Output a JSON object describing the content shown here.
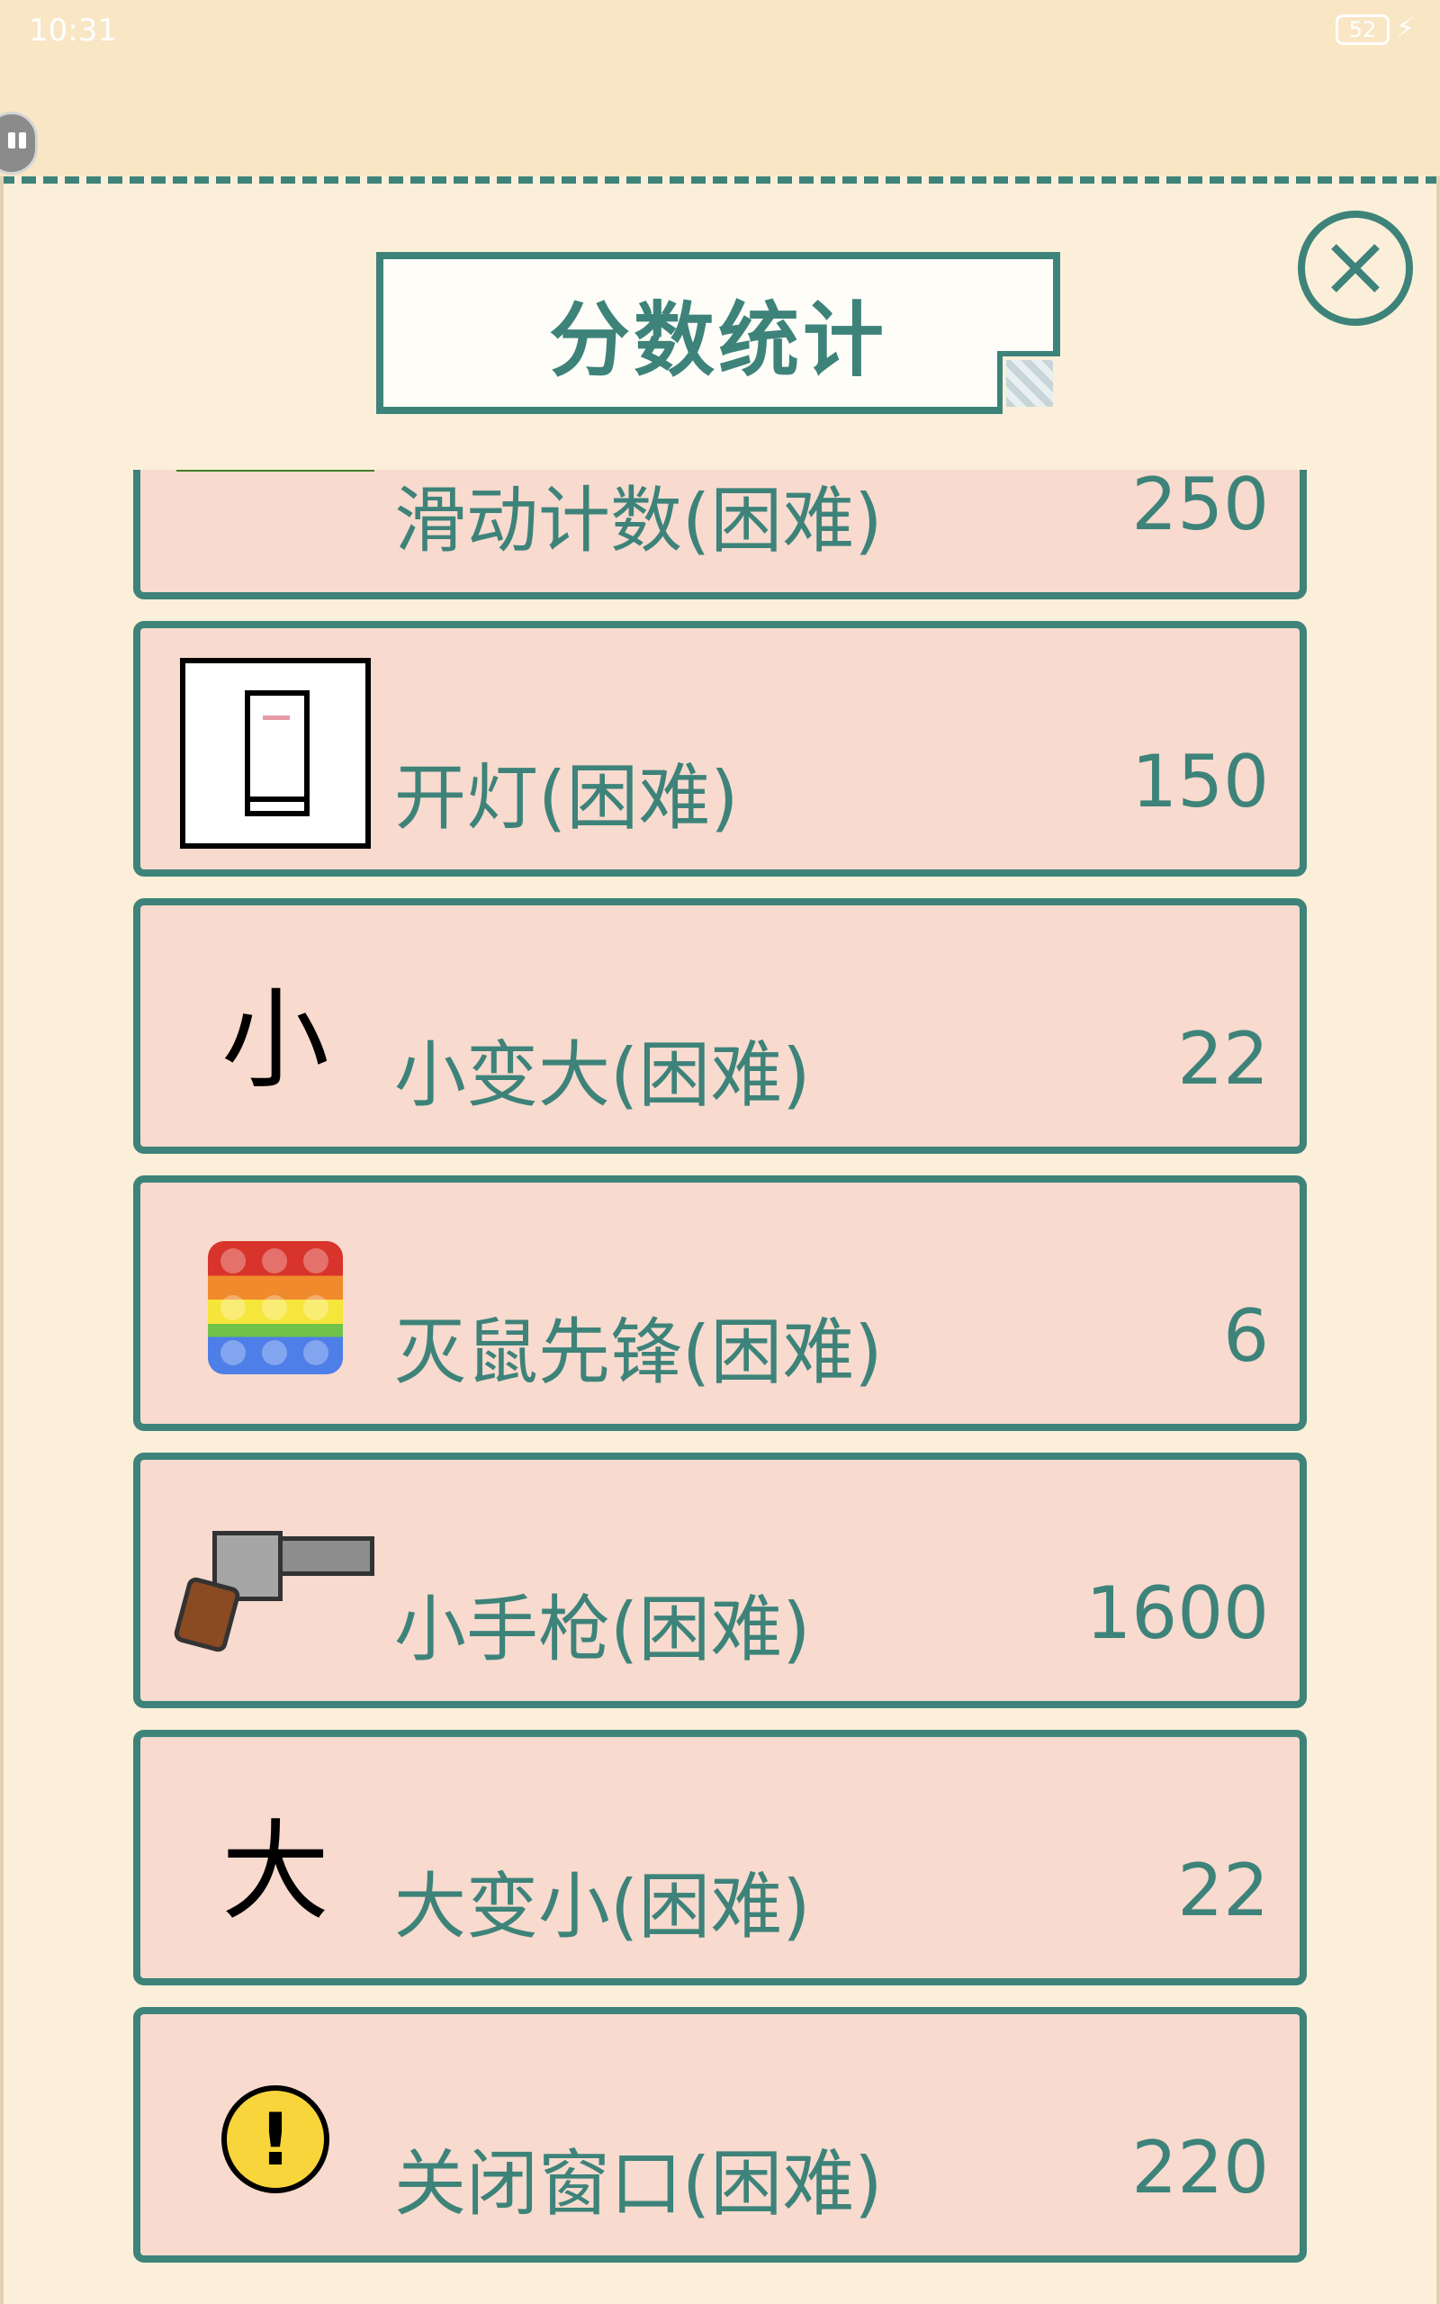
{
  "status_bar": {
    "time": "10:31",
    "battery": "52"
  },
  "panel": {
    "title": "分数统计"
  },
  "items": [
    {
      "icon": "counter-icon",
      "name": "滑动计数(困难)",
      "score": "250"
    },
    {
      "icon": "light-switch-icon",
      "name": "开灯(困难)",
      "score": "150"
    },
    {
      "icon": "small-char-icon",
      "icon_text": "小",
      "name": "小变大(困难)",
      "score": "22"
    },
    {
      "icon": "pop-it-icon",
      "name": "灭鼠先锋(困难)",
      "score": "6"
    },
    {
      "icon": "revolver-icon",
      "name": "小手枪(困难)",
      "score": "1600"
    },
    {
      "icon": "big-char-icon",
      "icon_text": "大",
      "name": "大变小(困难)",
      "score": "22"
    },
    {
      "icon": "warning-icon",
      "icon_text": "!",
      "name": "关闭窗口(困难)",
      "score": "220"
    }
  ]
}
